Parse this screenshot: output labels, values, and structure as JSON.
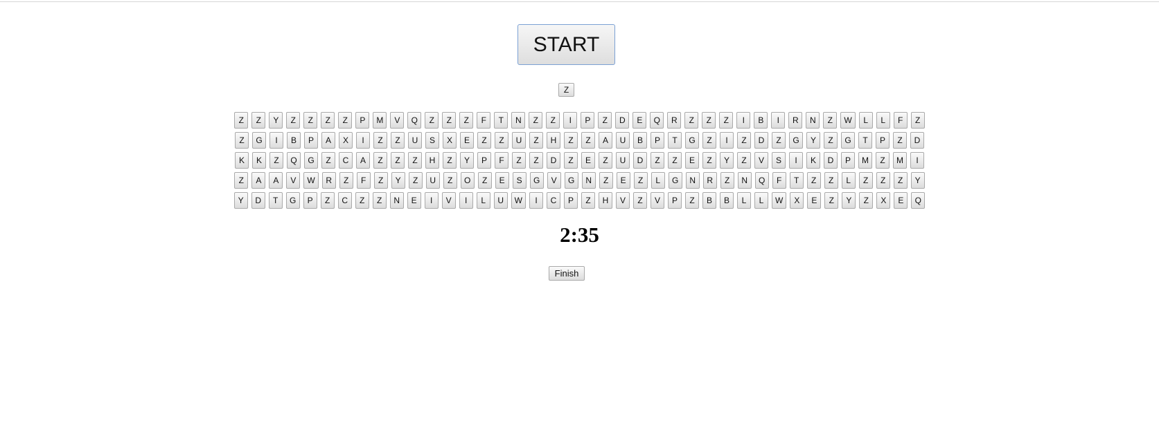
{
  "start_label": "START",
  "target_letter": "Z",
  "timer": "2:35",
  "finish_label": "Finish",
  "rows": [
    [
      "Z",
      "Z",
      "Y",
      "Z",
      "Z",
      "Z",
      "Z",
      "P",
      "M",
      "V",
      "Q",
      "Z",
      "Z",
      "Z",
      "F",
      "T",
      "N",
      "Z",
      "Z",
      "I",
      "P",
      "Z",
      "D",
      "E",
      "Q",
      "R",
      "Z",
      "Z",
      "Z",
      "I",
      "B",
      "I",
      "R",
      "N",
      "Z",
      "W",
      "L",
      "L",
      "F",
      "Z"
    ],
    [
      "Z",
      "G",
      "I",
      "B",
      "P",
      "A",
      "X",
      "I",
      "Z",
      "Z",
      "U",
      "S",
      "X",
      "E",
      "Z",
      "Z",
      "U",
      "Z",
      "H",
      "Z",
      "Z",
      "A",
      "U",
      "B",
      "P",
      "T",
      "G",
      "Z",
      "I",
      "Z",
      "D",
      "Z",
      "G",
      "Y",
      "Z",
      "G",
      "T",
      "P",
      "Z",
      "D"
    ],
    [
      "K",
      "K",
      "Z",
      "Q",
      "G",
      "Z",
      "C",
      "A",
      "Z",
      "Z",
      "Z",
      "H",
      "Z",
      "Y",
      "P",
      "F",
      "Z",
      "Z",
      "D",
      "Z",
      "E",
      "Z",
      "U",
      "D",
      "Z",
      "Z",
      "E",
      "Z",
      "Y",
      "Z",
      "V",
      "S",
      "I",
      "K",
      "D",
      "P",
      "M",
      "Z",
      "M",
      "I"
    ],
    [
      "Z",
      "A",
      "A",
      "V",
      "W",
      "R",
      "Z",
      "F",
      "Z",
      "Y",
      "Z",
      "U",
      "Z",
      "O",
      "Z",
      "E",
      "S",
      "G",
      "V",
      "G",
      "N",
      "Z",
      "E",
      "Z",
      "L",
      "G",
      "N",
      "R",
      "Z",
      "N",
      "Q",
      "F",
      "T",
      "Z",
      "Z",
      "L",
      "Z",
      "Z",
      "Z",
      "Y"
    ],
    [
      "Y",
      "D",
      "T",
      "G",
      "P",
      "Z",
      "C",
      "Z",
      "Z",
      "N",
      "E",
      "I",
      "V",
      "I",
      "L",
      "U",
      "W",
      "I",
      "C",
      "P",
      "Z",
      "H",
      "V",
      "Z",
      "V",
      "P",
      "Z",
      "B",
      "B",
      "L",
      "L",
      "W",
      "X",
      "E",
      "Z",
      "Y",
      "Z",
      "X",
      "E",
      "Q"
    ]
  ]
}
